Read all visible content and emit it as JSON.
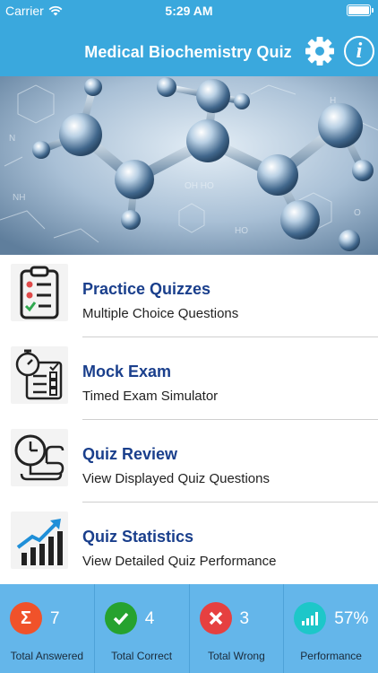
{
  "status_bar": {
    "carrier": "Carrier",
    "time": "5:29 AM"
  },
  "nav": {
    "title": "Medical Biochemistry Quiz",
    "settings_icon": "gear-icon",
    "info_icon": "info-icon"
  },
  "hero": {
    "image": "molecule-illustration"
  },
  "menu": [
    {
      "title": "Practice Quizzes",
      "subtitle": "Multiple Choice Questions",
      "icon": "clipboard-checklist-icon"
    },
    {
      "title": "Mock Exam",
      "subtitle": "Timed Exam Simulator",
      "icon": "stopwatch-checklist-icon"
    },
    {
      "title": "Quiz Review",
      "subtitle": "View Displayed Quiz Questions",
      "icon": "clock-scroll-icon"
    },
    {
      "title": "Quiz Statistics",
      "subtitle": "View Detailed Quiz Performance",
      "icon": "growth-chart-icon"
    }
  ],
  "stats": [
    {
      "label": "Total Answered",
      "value": "7",
      "color": "#f0522a",
      "icon": "sigma-icon"
    },
    {
      "label": "Total Correct",
      "value": "4",
      "color": "#26a22f",
      "icon": "checkmark-icon"
    },
    {
      "label": "Total Wrong",
      "value": "3",
      "color": "#e64040",
      "icon": "cross-icon"
    },
    {
      "label": "Performance",
      "value": "57%",
      "color": "#1dc7c9",
      "icon": "bar-chart-icon"
    }
  ],
  "colors": {
    "header": "#3aa8dd",
    "stats_bar": "#64b6ea",
    "menu_title": "#1a3f8c"
  }
}
